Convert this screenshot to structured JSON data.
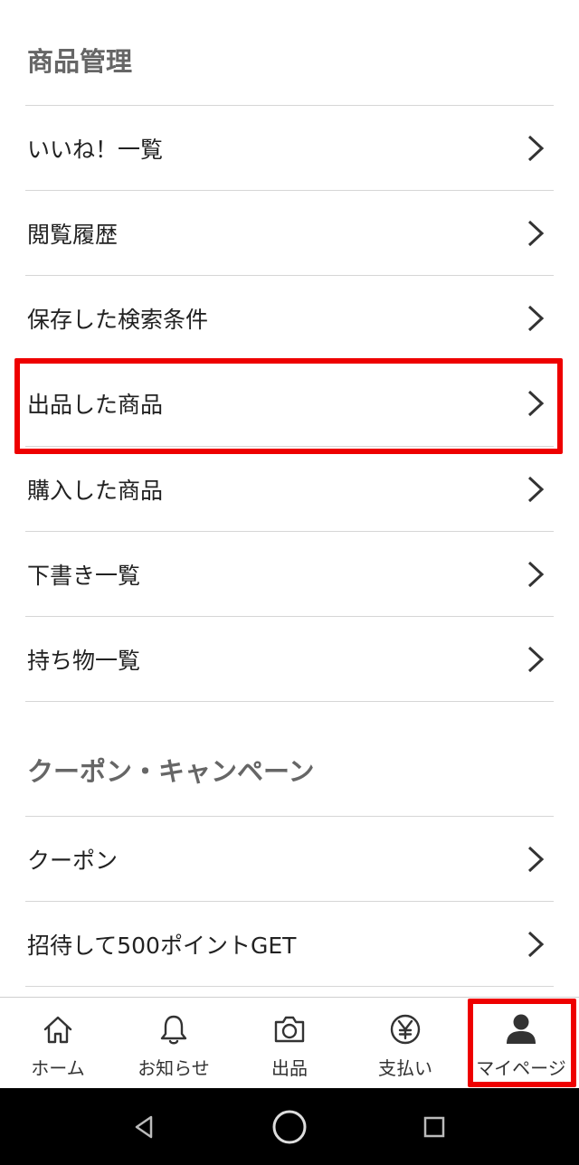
{
  "sections": {
    "management": {
      "title": "商品管理",
      "items": [
        {
          "label": "いいね！一覧"
        },
        {
          "label": "閲覧履歴"
        },
        {
          "label": "保存した検索条件"
        },
        {
          "label": "出品した商品"
        },
        {
          "label": "購入した商品"
        },
        {
          "label": "下書き一覧"
        },
        {
          "label": "持ち物一覧"
        }
      ]
    },
    "coupon": {
      "title": "クーポン・キャンペーン",
      "items": [
        {
          "label": "クーポン"
        },
        {
          "label": "招待して500ポイントGET"
        }
      ]
    }
  },
  "tabbar": {
    "tabs": [
      {
        "label": "ホーム",
        "icon": "home-icon"
      },
      {
        "label": "お知らせ",
        "icon": "bell-icon"
      },
      {
        "label": "出品",
        "icon": "camera-icon"
      },
      {
        "label": "支払い",
        "icon": "yen-icon"
      },
      {
        "label": "マイページ",
        "icon": "person-icon"
      }
    ],
    "active_index": 4
  },
  "system_nav": {
    "buttons": [
      "back-icon",
      "home-circle-icon",
      "recents-icon"
    ]
  },
  "colors": {
    "highlight": "#ee0000",
    "divider": "#d6d6d6",
    "section_header": "#666666",
    "text": "#222222",
    "nav_background": "#000000"
  }
}
